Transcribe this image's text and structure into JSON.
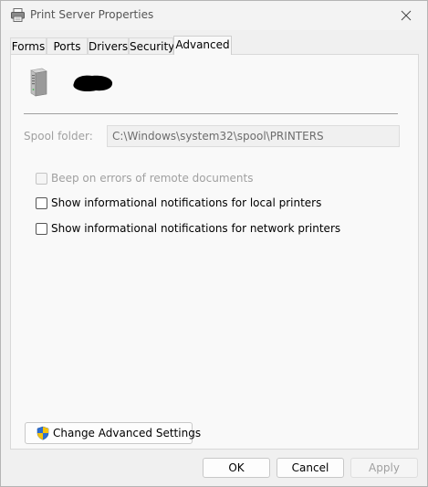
{
  "window": {
    "title": "Print Server Properties"
  },
  "tabs": [
    {
      "label": "Forms"
    },
    {
      "label": "Ports"
    },
    {
      "label": "Drivers"
    },
    {
      "label": "Security"
    },
    {
      "label": "Advanced",
      "active": true
    }
  ],
  "advanced": {
    "spool_label": "Spool folder:",
    "spool_value": "C:\\Windows\\system32\\spool\\PRINTERS",
    "options": [
      {
        "label": "Beep on errors of remote documents",
        "checked": false,
        "disabled": true
      },
      {
        "label": "Show informational notifications for local printers",
        "checked": false,
        "disabled": false
      },
      {
        "label": "Show informational notifications for network printers",
        "checked": false,
        "disabled": false
      }
    ],
    "change_button": "Change Advanced Settings"
  },
  "buttons": {
    "ok": "OK",
    "cancel": "Cancel",
    "apply": "Apply"
  },
  "icons": {
    "title": "printer-icon",
    "close": "close-icon",
    "server": "server-icon",
    "uac": "uac-shield-icon"
  },
  "colors": {
    "panel": "#f9f9f9",
    "disabled_text": "#a0a0a0",
    "shield_blue": "#2d6fd2",
    "shield_yellow": "#f4c20d"
  }
}
